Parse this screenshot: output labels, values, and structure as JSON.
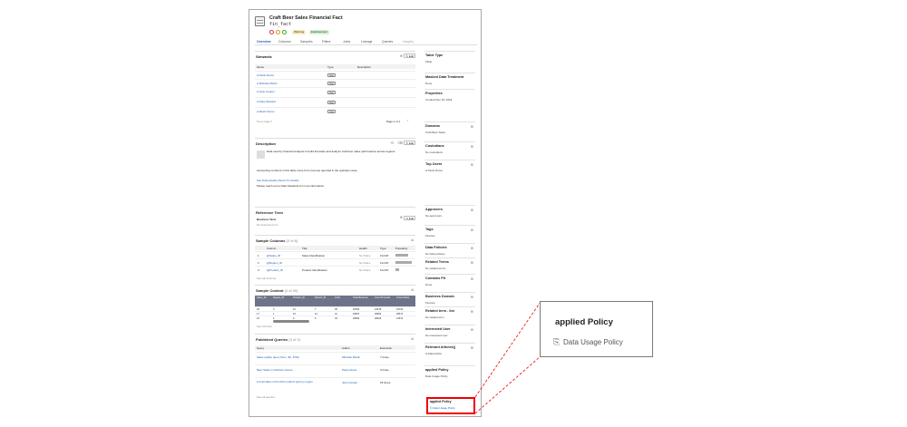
{
  "header": {
    "title": "Craft Beer Sales Financial Fact",
    "subtitle": "fin_fact",
    "badges": [
      "Warning",
      "Endorsement"
    ]
  },
  "tabs": [
    "Overview",
    "Columns",
    "Samples",
    "Filters",
    "Joins",
    "Lineage",
    "Queries",
    "Insights"
  ],
  "stewards": {
    "title": "Stewards",
    "headers": [
      "Name",
      "Type",
      "Description"
    ],
    "rows": [
      {
        "name": "A Paolo Rossi",
        "type": "User"
      },
      {
        "name": "A Michelle Martin",
        "type": "User"
      },
      {
        "name": "A Jane Cooper",
        "type": "User"
      },
      {
        "name": "A Data Steward",
        "type": "User"
      },
      {
        "name": "A Albert Flores",
        "type": "User"
      }
    ],
    "pagination": "Page 1 of 1"
  },
  "description": {
    "title": "Description",
    "text1": "Data used by financial analysts to build forecasts and analyze craft beer sales performance across regions.",
    "text2": "Accounting numbers in this table come from revenue reported in the quarterly close.",
    "text3": "See Data Quality Report for details.",
    "text4": "Please reach out to Data Stewards for more information."
  },
  "reference": {
    "title": "Reference Term",
    "label": "Business Term",
    "empty": "No business term"
  },
  "sample_columns": {
    "title": "Sample Columns",
    "count": "(3 of 6)",
    "headers": [
      "Column",
      "Title",
      "Health",
      "Type",
      "Popularity"
    ],
    "rows": [
      {
        "num": "1",
        "col": "@Sales_ID",
        "title": "Sales Identification",
        "health": "No Rules",
        "type": "FLOAT"
      },
      {
        "num": "2",
        "col": "@Region_ID",
        "title": "",
        "health": "No Rules",
        "type": "FLOAT"
      },
      {
        "num": "3",
        "col": "@Product_ID",
        "title": "Product Identification",
        "health": "No Rules",
        "type": "FLOAT"
      }
    ],
    "more": "See all columns"
  },
  "sample_content": {
    "title": "Sample Content",
    "count": "(3 of 20)",
    "headers": [
      "Sales_ID",
      "Region_ID",
      "Product_ID",
      "Branch_ID",
      "Units",
      "Total Revenue",
      "Cost Of Goods",
      "Gross Sales"
    ],
    "rows": [
      [
        "18",
        "3",
        "12",
        "7",
        "45",
        "49782",
        "22478",
        "42734"
      ],
      [
        "17",
        "1",
        "10",
        "12",
        "41",
        "62537",
        "30482",
        "30671"
      ],
      [
        "21",
        "2",
        "9",
        "5",
        "33",
        "36630",
        "36426",
        "21673"
      ]
    ],
    "more": "See 20 rows"
  },
  "published_queries": {
    "title": "Published Queries",
    "count": "(3 of 3)",
    "headers": [
      "Query",
      "Author",
      "Execution"
    ],
    "rows": [
      {
        "query": "Sales quality query (Nov, 4th, 8:09)",
        "author": "Michelle Martin",
        "exec": "7 times"
      },
      {
        "query": "Beer Sales in Northern Zones",
        "author": "Paolo Rossi",
        "exec": "3 times"
      },
      {
        "query": "List all sales of the third product type by region",
        "author": "Jane Cooper",
        "exec": "18 times"
      }
    ],
    "more": "See all queries"
  },
  "sidebar": [
    {
      "title": "Table Type",
      "value": "Table"
    },
    {
      "title": "Masked Data Treatment",
      "value": "None"
    },
    {
      "title": "Properties",
      "value": "Created Dec 18, 2018"
    },
    {
      "title": "Domains",
      "value": "Craft Beer Sales"
    },
    {
      "title": "Custodians",
      "value": "No custodians"
    },
    {
      "title": "Top Users",
      "value": "A Paolo Rossi"
    },
    {
      "title": "Approvers",
      "value": "No approvers"
    },
    {
      "title": "Tags",
      "value": "Finance"
    },
    {
      "title": "Data Policies",
      "value": "No data policies"
    },
    {
      "title": "Related Terms",
      "value": "No related terms"
    },
    {
      "title": "Contains PII",
      "value": "None"
    },
    {
      "title": "Business Domain",
      "value": "Finance"
    },
    {
      "title": "Related term - list",
      "value": "No related term"
    },
    {
      "title": "Interested User",
      "value": "No interested user"
    },
    {
      "title": "Relevant Articles()",
      "value": "A Data Article"
    },
    {
      "title": "applied Policy",
      "value": "Data Usage Policy"
    }
  ],
  "popup": {
    "title": "applied Policy",
    "item": "Data Usage Policy"
  },
  "colors": {
    "highlight": "#e00000",
    "link": "#1a5fb4"
  }
}
